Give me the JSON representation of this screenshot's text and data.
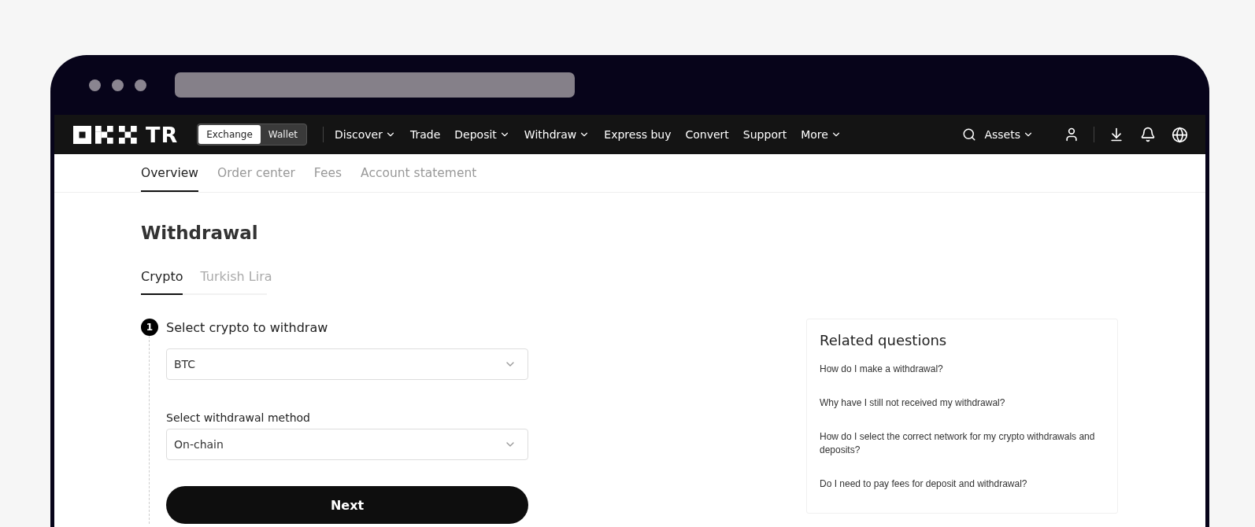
{
  "header": {
    "logo_suffix": "TR",
    "mode_toggle": [
      {
        "label": "Exchange",
        "selected": true
      },
      {
        "label": "Wallet",
        "selected": false
      }
    ],
    "nav": [
      {
        "label": "Discover",
        "dropdown": true
      },
      {
        "label": "Trade",
        "dropdown": false
      },
      {
        "label": "Deposit",
        "dropdown": true
      },
      {
        "label": "Withdraw",
        "dropdown": true
      },
      {
        "label": "Express buy",
        "dropdown": false
      },
      {
        "label": "Convert",
        "dropdown": false
      },
      {
        "label": "Support",
        "dropdown": false
      },
      {
        "label": "More",
        "dropdown": true
      }
    ],
    "assets": "Assets"
  },
  "subnav": [
    {
      "label": "Overview",
      "selected": true
    },
    {
      "label": "Order center",
      "selected": false
    },
    {
      "label": "Fees",
      "selected": false
    },
    {
      "label": "Account statement",
      "selected": false
    }
  ],
  "page_title": "Withdrawal",
  "tabs": [
    {
      "label": "Crypto",
      "selected": true
    },
    {
      "label": "Turkish Lira",
      "selected": false
    }
  ],
  "step": {
    "number": "1",
    "title": "Select crypto to withdraw",
    "crypto_select": {
      "value": "BTC"
    },
    "method_label": "Select withdrawal method",
    "method_select": {
      "value": "On-chain"
    },
    "next_button": "Next"
  },
  "related": {
    "title": "Related questions",
    "questions": [
      "How do I make a withdrawal?",
      "Why have I still not received my withdrawal?",
      "How do I select the correct network for my crypto withdrawals and deposits?",
      "Do I need to pay fees for deposit and withdrawal?"
    ]
  }
}
